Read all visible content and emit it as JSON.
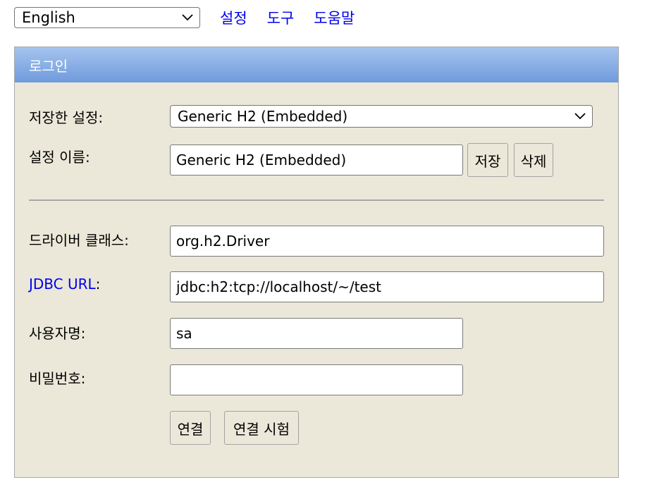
{
  "top": {
    "language_value": "English",
    "links": {
      "settings": "설정",
      "tools": "도구",
      "help": "도움말"
    }
  },
  "panel": {
    "title": "로그인",
    "saved_settings_label": "저장한 설정:",
    "saved_settings_value": "Generic H2 (Embedded)",
    "setting_name_label": "설정 이름:",
    "setting_name_value": "Generic H2 (Embedded)",
    "save_button": "저장",
    "delete_button": "삭제",
    "driver_class_label": "드라이버 클래스:",
    "driver_class_value": "org.h2.Driver",
    "jdbc_url_link": "JDBC URL",
    "jdbc_url_colon": ":",
    "jdbc_url_value": "jdbc:h2:tcp://localhost/~/test",
    "username_label": "사용자명:",
    "username_value": "sa",
    "password_label": "비밀번호:",
    "password_value": "",
    "connect_button": "연결",
    "test_connection_button": "연결 시험"
  },
  "colors": {
    "panel_bg": "#ebe8da",
    "header_gradient_top": "#a5c4ef",
    "header_gradient_bottom": "#6f9bdc",
    "link": "#0000ee"
  },
  "icons": {
    "dropdown": "chevron-down-icon"
  }
}
